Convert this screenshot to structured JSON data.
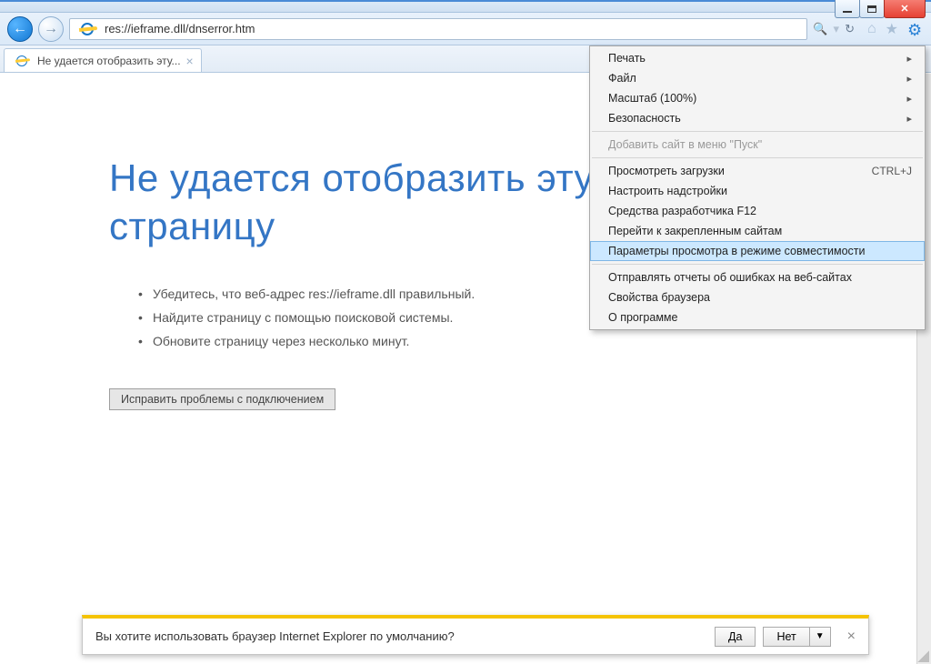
{
  "window": {
    "address_url": "res://ieframe.dll/dnserror.htm"
  },
  "tab": {
    "title": "Не удается отобразить эту..."
  },
  "toolbar": {
    "search_icon_title": "Поиск",
    "refresh_icon_title": "Обновить"
  },
  "errorpage": {
    "heading": "Не удается отобразить эту страницу",
    "bullets": [
      "Убедитесь, что веб-адрес res://ieframe.dll правильный.",
      "Найдите страницу с помощью поисковой системы.",
      "Обновите страницу через несколько минут."
    ],
    "fix_button": "Исправить проблемы с подключением"
  },
  "menu": {
    "items": [
      {
        "label": "Печать",
        "submenu": true
      },
      {
        "label": "Файл",
        "submenu": true
      },
      {
        "label": "Масштаб (100%)",
        "submenu": true
      },
      {
        "label": "Безопасность",
        "submenu": true
      }
    ],
    "addstart": "Добавить сайт в меню \"Пуск\"",
    "downloads": {
      "label": "Просмотреть загрузки",
      "shortcut": "CTRL+J"
    },
    "addons": "Настроить надстройки",
    "devtools": "Средства разработчика F12",
    "pinned": "Перейти к закрепленным сайтам",
    "compat": "Параметры просмотра в режиме совместимости",
    "report": "Отправлять отчеты об ошибках на веб-сайтах",
    "options": "Свойства браузера",
    "about": "О программе"
  },
  "prompt": {
    "text": "Вы хотите использовать браузер Internet Explorer по умолчанию?",
    "yes": "Да",
    "no": "Нет"
  }
}
